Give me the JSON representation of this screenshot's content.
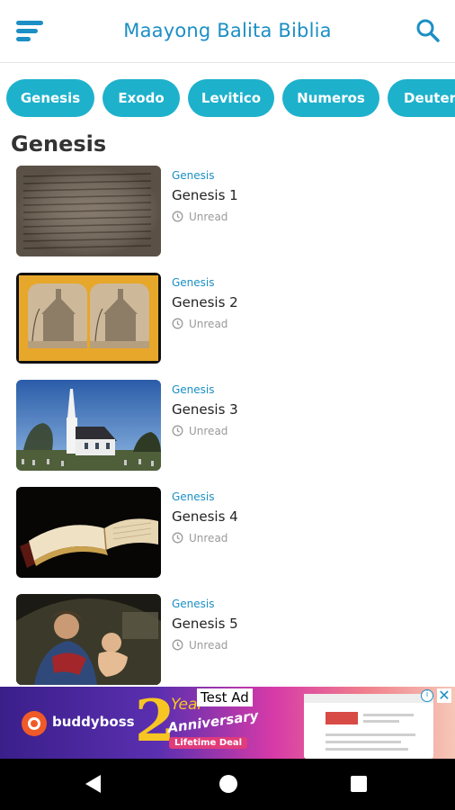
{
  "appbar": {
    "title": "Maayong Balita Biblia"
  },
  "chips": [
    "Genesis",
    "Exodo",
    "Levitico",
    "Numeros",
    "Deuter"
  ],
  "section_title": "Genesis",
  "items": [
    {
      "category": "Genesis",
      "title": "Genesis 1",
      "status": "Unread"
    },
    {
      "category": "Genesis",
      "title": "Genesis 2",
      "status": "Unread"
    },
    {
      "category": "Genesis",
      "title": "Genesis 3",
      "status": "Unread"
    },
    {
      "category": "Genesis",
      "title": "Genesis 4",
      "status": "Unread"
    },
    {
      "category": "Genesis",
      "title": "Genesis 5",
      "status": "Unread"
    }
  ],
  "ad": {
    "label": "Test Ad",
    "brand": "buddyboss",
    "big_number": "2",
    "year_text": "Year",
    "anniversary_text": "Anniversary",
    "deal_text": "Lifetime Deal",
    "info_glyph": "i",
    "close_glyph": "✕"
  },
  "colors": {
    "accent": "#1c8fc4",
    "chip": "#1eb1cc"
  }
}
